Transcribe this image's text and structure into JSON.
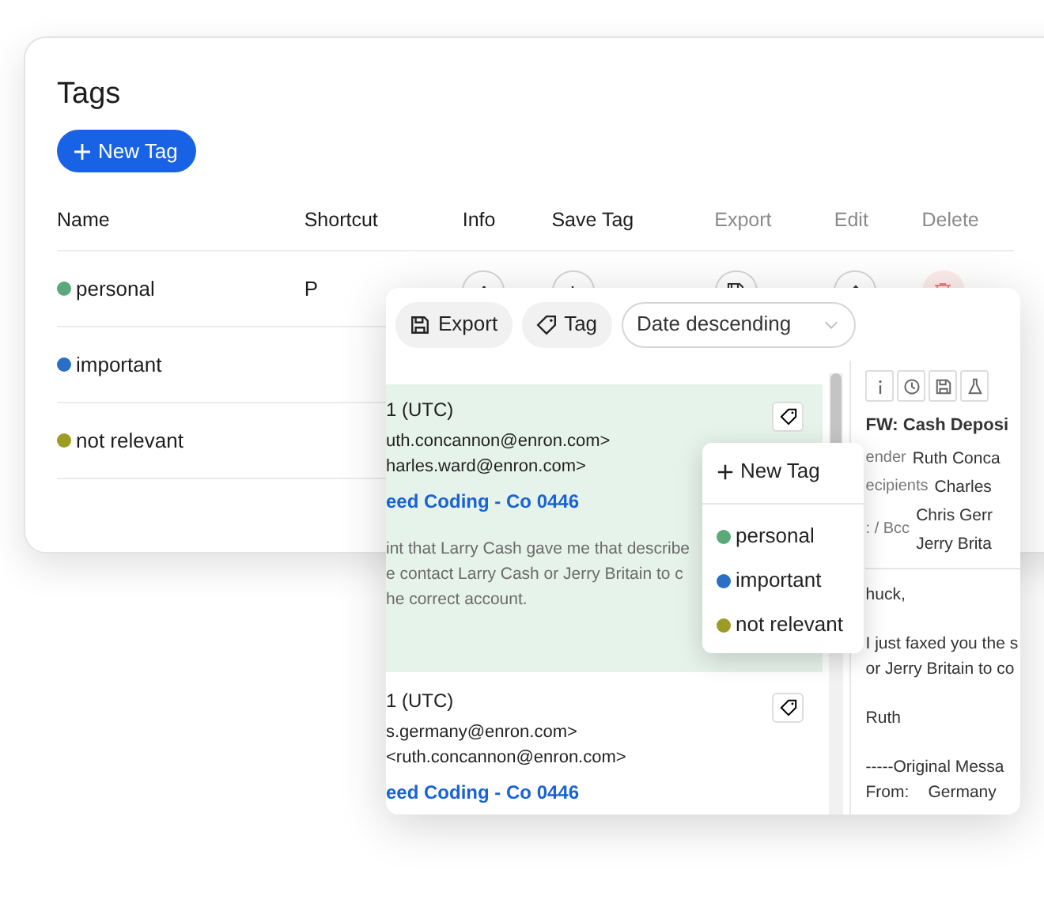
{
  "tags_panel": {
    "title": "Tags",
    "new_button": "New Tag",
    "columns": [
      {
        "label": "Name",
        "muted": false
      },
      {
        "label": "Shortcut",
        "muted": false
      },
      {
        "label": "Info",
        "muted": false
      },
      {
        "label": "Save Tag",
        "muted": false
      },
      {
        "label": "Export",
        "muted": true
      },
      {
        "label": "Edit",
        "muted": true
      },
      {
        "label": "Delete",
        "muted": true
      }
    ],
    "rows": [
      {
        "name": "personal",
        "color": "#5aa97a",
        "shortcut": "P"
      },
      {
        "name": "important",
        "color": "#2a6ec6"
      },
      {
        "name": "not relevant",
        "color": "#9a9c23"
      }
    ]
  },
  "email_window": {
    "toolbar": {
      "export": "Export",
      "tag": "Tag",
      "sort": "Date descending"
    },
    "emails": [
      {
        "selected": true,
        "date": "1 (UTC)",
        "lines": [
          "uth.concannon@enron.com>",
          "harles.ward@enron.com>"
        ],
        "subject": "eed Coding - Co 0446",
        "snippet": [
          "int that Larry Cash gave me that describe",
          "e contact Larry Cash or Jerry Britain to c",
          "he correct account."
        ]
      },
      {
        "selected": false,
        "date": "1 (UTC)",
        "lines": [
          "s.germany@enron.com>",
          "<ruth.concannon@enron.com>"
        ],
        "subject": "eed Coding - Co 0446"
      }
    ],
    "detail": {
      "subject": "FW: Cash Deposi",
      "fields": [
        {
          "label": "ender",
          "values": [
            "Ruth Conca"
          ]
        },
        {
          "label": "ecipients",
          "values": [
            "Charles"
          ]
        },
        {
          "label": ": / Bcc",
          "values": [
            "Chris Gerr",
            "Jerry Brita"
          ]
        }
      ],
      "paragraphs": [
        [
          "huck,"
        ],
        [
          "I just faxed you the s",
          "or Jerry Britain to co"
        ],
        [
          "Ruth"
        ],
        [
          "-----Original Messa"
        ]
      ],
      "from_label": "From:",
      "from_value": "Germany"
    }
  },
  "tag_menu": {
    "new": "New Tag",
    "items": [
      {
        "name": "personal",
        "color": "#5aa97a"
      },
      {
        "name": "important",
        "color": "#2a6ec6"
      },
      {
        "name": "not relevant",
        "color": "#9a9c23"
      }
    ]
  }
}
